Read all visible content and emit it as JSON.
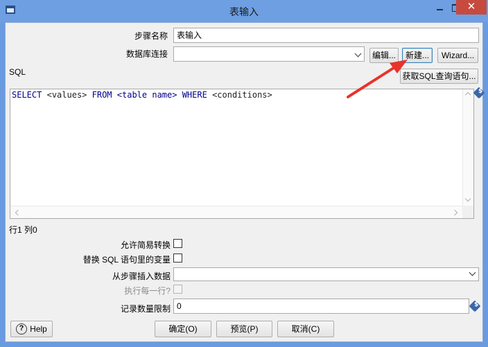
{
  "window": {
    "title": "表输入",
    "close_glyph": "✕"
  },
  "form": {
    "step_name_label": "步骤名称",
    "step_name_value": "表输入",
    "db_conn_label": "数据库连接",
    "db_conn_value": "",
    "edit_button": "编辑...",
    "new_button": "新建...",
    "wizard_button": "Wizard...",
    "sql_label": "SQL",
    "get_sql_button": "获取SQL查询语句...",
    "cursor_pos": "行1 列0",
    "allow_lazy_label": "允许简易转换",
    "replace_vars_label": "替换 SQL 语句里的变量",
    "insert_from_label": "从步骤插入数据",
    "insert_from_value": "",
    "execute_each_label": "执行每一行?",
    "limit_label": "记录数量限制",
    "limit_value": "0",
    "variable_glyph": "$"
  },
  "sql": {
    "kw_select": "SELECT",
    "values": "<values>",
    "kw_from": "FROM",
    "table": "<table name>",
    "kw_where": "WHERE",
    "conditions": "<conditions>"
  },
  "footer": {
    "help_glyph": "?",
    "help_button": "Help",
    "ok_button": "确定(O)",
    "preview_button": "预览(P)",
    "cancel_button": "取消(C)"
  },
  "annotation": {
    "color": "#e8332a"
  }
}
